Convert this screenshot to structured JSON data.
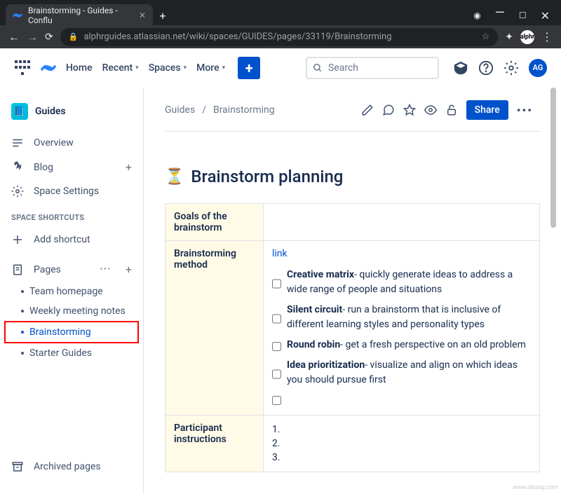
{
  "browser": {
    "tab_title": "Brainstorming - Guides - Conflu",
    "url": "alphrguides.atlassian.net/wiki/spaces/GUIDES/pages/33119/Brainstorming"
  },
  "nav": {
    "home": "Home",
    "recent": "Recent",
    "spaces": "Spaces",
    "more": "More",
    "search_placeholder": "Search"
  },
  "avatar": "AG",
  "sidebar": {
    "space": "Guides",
    "overview": "Overview",
    "blog": "Blog",
    "settings": "Space Settings",
    "shortcuts_label": "SPACE SHORTCUTS",
    "add_shortcut": "Add shortcut",
    "pages_label": "Pages",
    "pages": [
      {
        "label": "Team homepage"
      },
      {
        "label": "Weekly meeting notes"
      },
      {
        "label": "Brainstorming"
      },
      {
        "label": "Starter Guides"
      }
    ],
    "archived": "Archived pages"
  },
  "breadcrumb": {
    "space": "Guides",
    "page": "Brainstorming"
  },
  "share": "Share",
  "page": {
    "title": "Brainstorm planning",
    "rows": {
      "goals": "Goals of the brainstorm",
      "method": "Brainstorming method",
      "participants": "Participant instructions"
    },
    "link_label": "link",
    "methods": [
      {
        "name": "Creative matrix",
        "desc": "- quickly generate ideas to address a wide range of people and situations"
      },
      {
        "name": "Silent circuit",
        "desc": "- run a brainstorm that is inclusive of different learning styles and personality types"
      },
      {
        "name": "Round robin",
        "desc": "- get a fresh perspective on an old problem"
      },
      {
        "name": "Idea prioritization",
        "desc": "- visualize and align on which ideas you should pursue first"
      }
    ],
    "ol": [
      "1.",
      "2.",
      "3."
    ]
  },
  "watermark": "www.deuaq.com"
}
